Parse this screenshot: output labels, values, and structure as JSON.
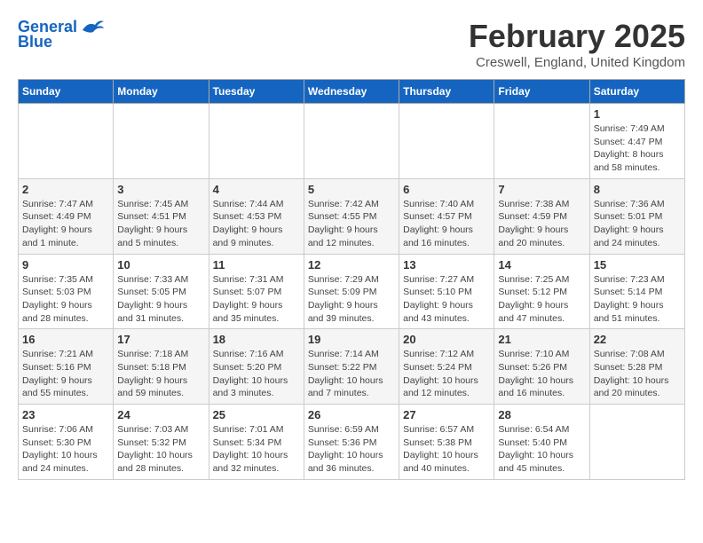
{
  "header": {
    "logo_line1": "General",
    "logo_line2": "Blue",
    "month_title": "February 2025",
    "location": "Creswell, England, United Kingdom"
  },
  "weekdays": [
    "Sunday",
    "Monday",
    "Tuesday",
    "Wednesday",
    "Thursday",
    "Friday",
    "Saturday"
  ],
  "weeks": [
    [
      {
        "day": "",
        "info": ""
      },
      {
        "day": "",
        "info": ""
      },
      {
        "day": "",
        "info": ""
      },
      {
        "day": "",
        "info": ""
      },
      {
        "day": "",
        "info": ""
      },
      {
        "day": "",
        "info": ""
      },
      {
        "day": "1",
        "info": "Sunrise: 7:49 AM\nSunset: 4:47 PM\nDaylight: 8 hours and 58 minutes."
      }
    ],
    [
      {
        "day": "2",
        "info": "Sunrise: 7:47 AM\nSunset: 4:49 PM\nDaylight: 9 hours and 1 minute."
      },
      {
        "day": "3",
        "info": "Sunrise: 7:45 AM\nSunset: 4:51 PM\nDaylight: 9 hours and 5 minutes."
      },
      {
        "day": "4",
        "info": "Sunrise: 7:44 AM\nSunset: 4:53 PM\nDaylight: 9 hours and 9 minutes."
      },
      {
        "day": "5",
        "info": "Sunrise: 7:42 AM\nSunset: 4:55 PM\nDaylight: 9 hours and 12 minutes."
      },
      {
        "day": "6",
        "info": "Sunrise: 7:40 AM\nSunset: 4:57 PM\nDaylight: 9 hours and 16 minutes."
      },
      {
        "day": "7",
        "info": "Sunrise: 7:38 AM\nSunset: 4:59 PM\nDaylight: 9 hours and 20 minutes."
      },
      {
        "day": "8",
        "info": "Sunrise: 7:36 AM\nSunset: 5:01 PM\nDaylight: 9 hours and 24 minutes."
      }
    ],
    [
      {
        "day": "9",
        "info": "Sunrise: 7:35 AM\nSunset: 5:03 PM\nDaylight: 9 hours and 28 minutes."
      },
      {
        "day": "10",
        "info": "Sunrise: 7:33 AM\nSunset: 5:05 PM\nDaylight: 9 hours and 31 minutes."
      },
      {
        "day": "11",
        "info": "Sunrise: 7:31 AM\nSunset: 5:07 PM\nDaylight: 9 hours and 35 minutes."
      },
      {
        "day": "12",
        "info": "Sunrise: 7:29 AM\nSunset: 5:09 PM\nDaylight: 9 hours and 39 minutes."
      },
      {
        "day": "13",
        "info": "Sunrise: 7:27 AM\nSunset: 5:10 PM\nDaylight: 9 hours and 43 minutes."
      },
      {
        "day": "14",
        "info": "Sunrise: 7:25 AM\nSunset: 5:12 PM\nDaylight: 9 hours and 47 minutes."
      },
      {
        "day": "15",
        "info": "Sunrise: 7:23 AM\nSunset: 5:14 PM\nDaylight: 9 hours and 51 minutes."
      }
    ],
    [
      {
        "day": "16",
        "info": "Sunrise: 7:21 AM\nSunset: 5:16 PM\nDaylight: 9 hours and 55 minutes."
      },
      {
        "day": "17",
        "info": "Sunrise: 7:18 AM\nSunset: 5:18 PM\nDaylight: 9 hours and 59 minutes."
      },
      {
        "day": "18",
        "info": "Sunrise: 7:16 AM\nSunset: 5:20 PM\nDaylight: 10 hours and 3 minutes."
      },
      {
        "day": "19",
        "info": "Sunrise: 7:14 AM\nSunset: 5:22 PM\nDaylight: 10 hours and 7 minutes."
      },
      {
        "day": "20",
        "info": "Sunrise: 7:12 AM\nSunset: 5:24 PM\nDaylight: 10 hours and 12 minutes."
      },
      {
        "day": "21",
        "info": "Sunrise: 7:10 AM\nSunset: 5:26 PM\nDaylight: 10 hours and 16 minutes."
      },
      {
        "day": "22",
        "info": "Sunrise: 7:08 AM\nSunset: 5:28 PM\nDaylight: 10 hours and 20 minutes."
      }
    ],
    [
      {
        "day": "23",
        "info": "Sunrise: 7:06 AM\nSunset: 5:30 PM\nDaylight: 10 hours and 24 minutes."
      },
      {
        "day": "24",
        "info": "Sunrise: 7:03 AM\nSunset: 5:32 PM\nDaylight: 10 hours and 28 minutes."
      },
      {
        "day": "25",
        "info": "Sunrise: 7:01 AM\nSunset: 5:34 PM\nDaylight: 10 hours and 32 minutes."
      },
      {
        "day": "26",
        "info": "Sunrise: 6:59 AM\nSunset: 5:36 PM\nDaylight: 10 hours and 36 minutes."
      },
      {
        "day": "27",
        "info": "Sunrise: 6:57 AM\nSunset: 5:38 PM\nDaylight: 10 hours and 40 minutes."
      },
      {
        "day": "28",
        "info": "Sunrise: 6:54 AM\nSunset: 5:40 PM\nDaylight: 10 hours and 45 minutes."
      },
      {
        "day": "",
        "info": ""
      }
    ]
  ]
}
